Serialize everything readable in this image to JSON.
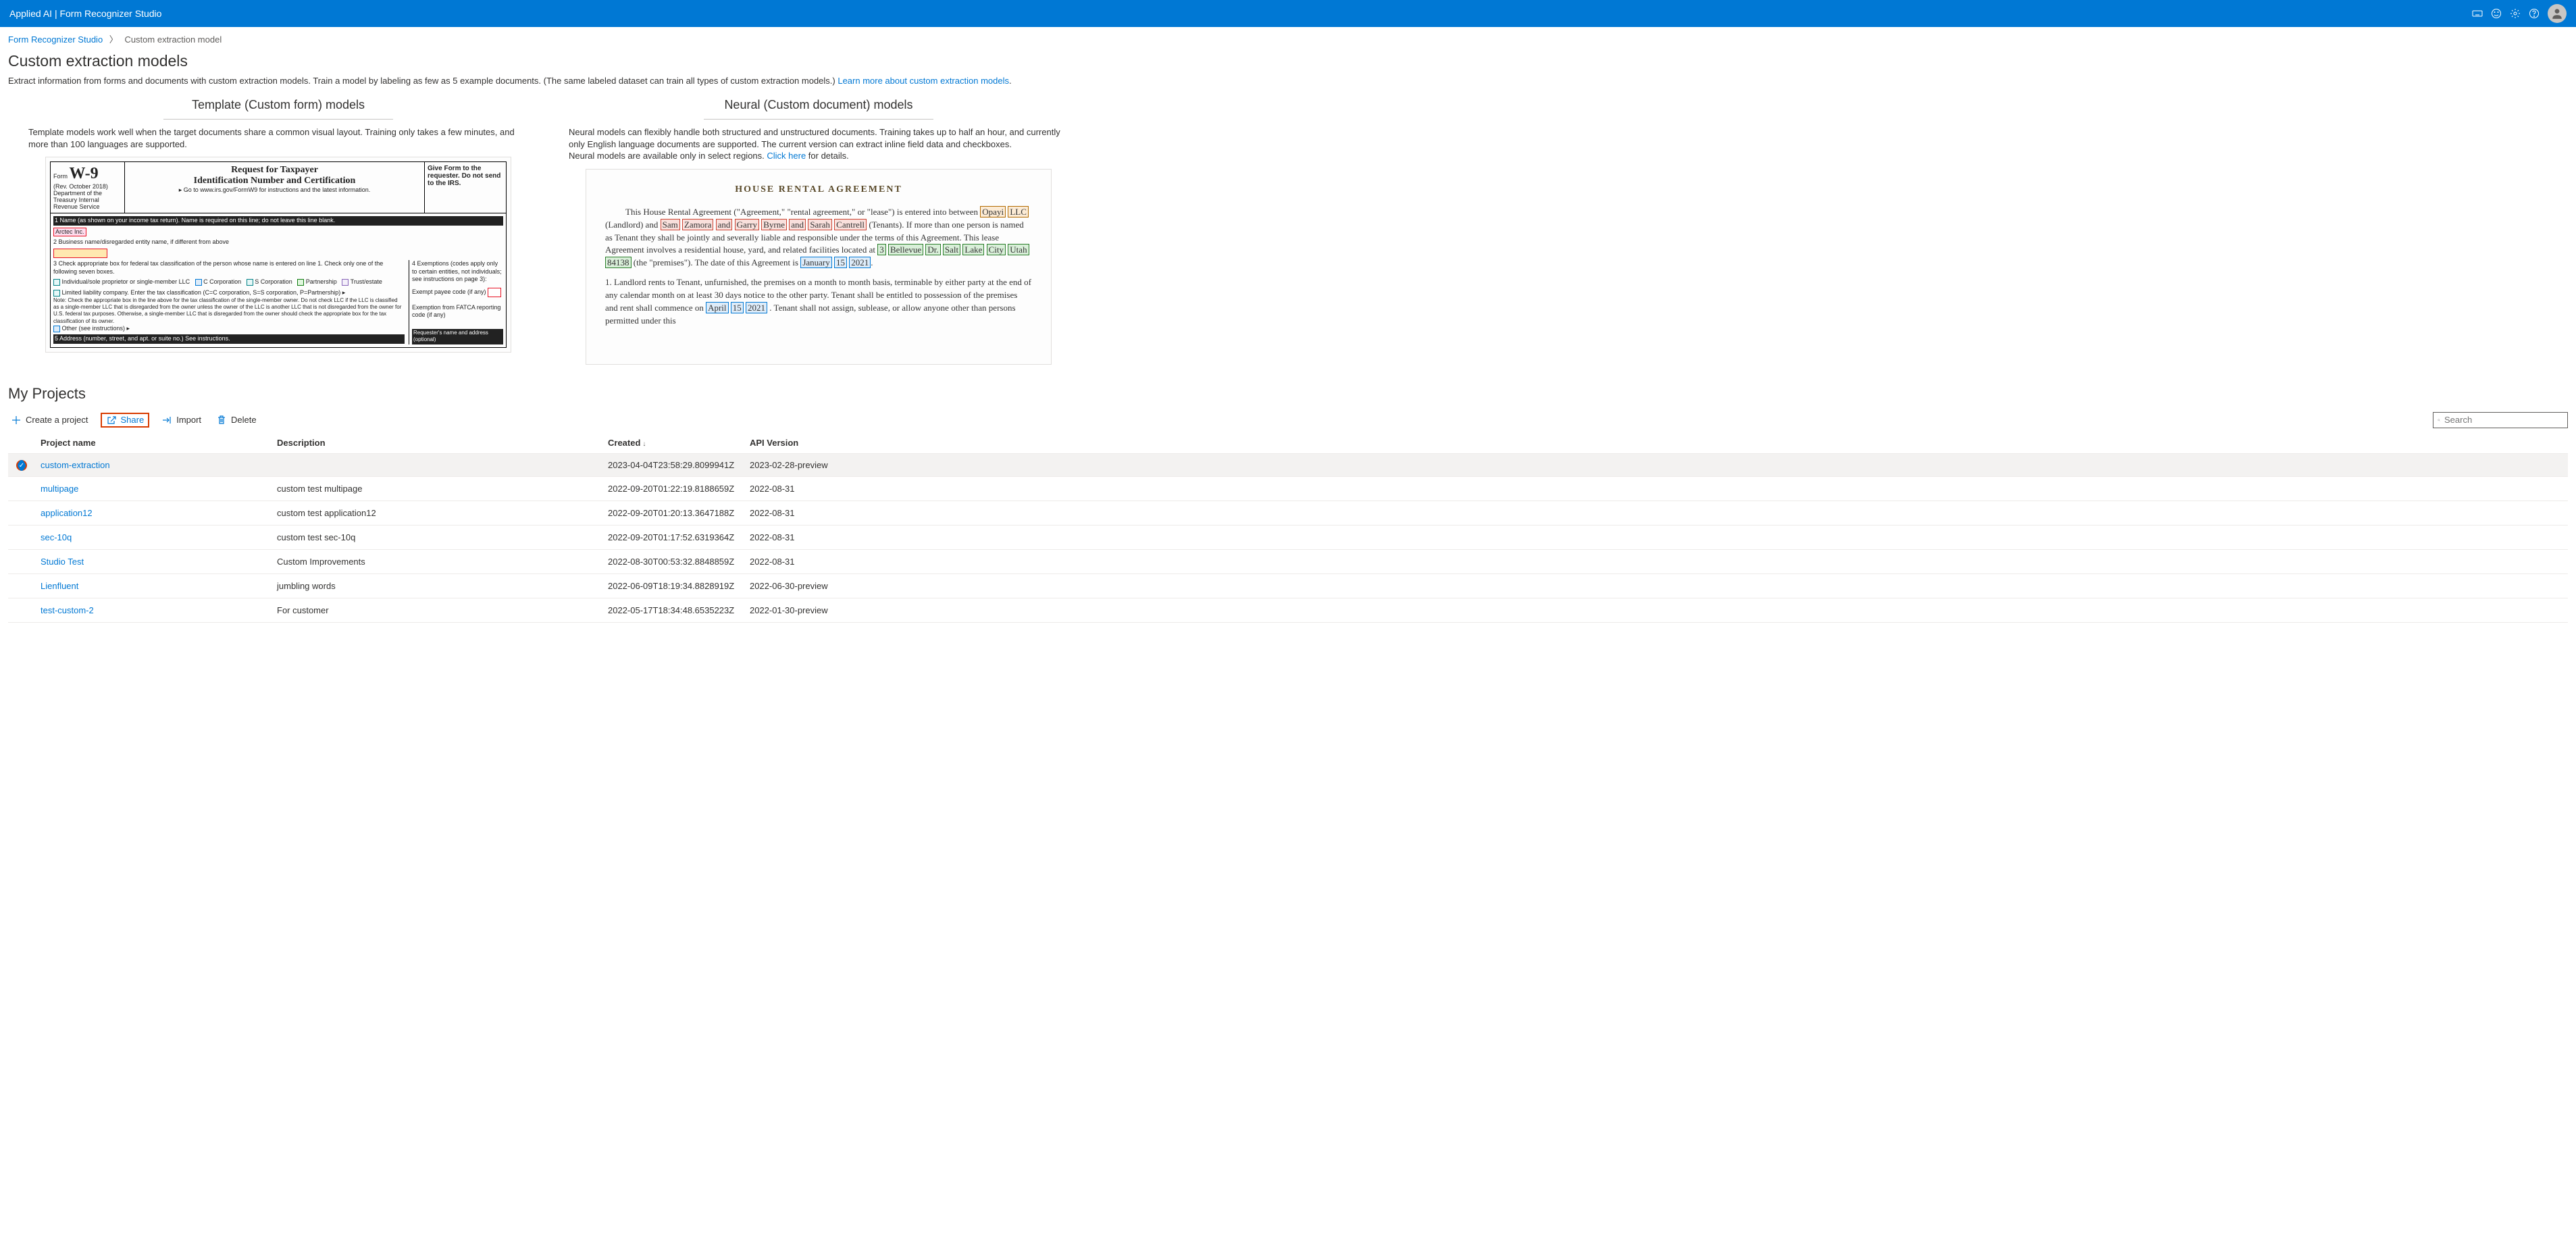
{
  "header": {
    "title": "Applied AI | Form Recognizer Studio"
  },
  "breadcrumb": {
    "root": "Form Recognizer Studio",
    "current": "Custom extraction model"
  },
  "page": {
    "title": "Custom extraction models",
    "desc_a": "Extract information from forms and documents with custom extraction models. Train a model by labeling as few as 5 example documents. (The same labeled dataset can train all types of custom extraction models.) ",
    "learn_link": "Learn more about custom extraction models",
    "desc_b": "."
  },
  "cols": {
    "template": {
      "title": "Template (Custom form) models",
      "desc": "Template models work well when the target documents share a common visual layout. Training only takes a few minutes, and more than 100 languages are supported."
    },
    "neural": {
      "title": "Neural (Custom document) models",
      "desc_a": "Neural models can flexibly handle both structured and unstructured documents. Training takes up to half an hour, and currently only English language documents are supported. The current version can extract inline field data and checkboxes.",
      "desc_b": "Neural models are available only in select regions. ",
      "click_here": "Click here",
      "desc_c": " for details."
    }
  },
  "w9": {
    "form_label": "Form",
    "big": "W-9",
    "rev": "(Rev. October 2018)",
    "dept": "Department of the Treasury Internal Revenue Service",
    "t1": "Request for Taxpayer",
    "t2": "Identification Number and Certification",
    "t3": "▸ Go to www.irs.gov/FormW9 for instructions and the latest information.",
    "right": "Give Form to the requester. Do not send to the IRS.",
    "line1": "1 Name (as shown on your income tax return). Name is required on this line; do not leave this line blank.",
    "name_hl": "Arctec Inc.",
    "line2": "2 Business name/disregarded entity name, if different from above",
    "line3": "3 Check appropriate box for federal tax classification of the person whose name is entered on line 1. Check only one of the following seven boxes.",
    "cb1": "Individual/sole proprietor or single-member LLC",
    "cb2": "C Corporation",
    "cb3": "S Corporation",
    "cb4": "Partnership",
    "cb5": "Trust/estate",
    "llc": "Limited liability company. Enter the tax classification (C=C corporation, S=S corporation, P=Partnership) ▸",
    "note": "Note: Check the appropriate box in the line above for the tax classification of the single-member owner. Do not check LLC if the LLC is classified as a single-member LLC that is disregarded from the owner unless the owner of the LLC is another LLC that is not disregarded from the owner for U.S. federal tax purposes. Otherwise, a single-member LLC that is disregarded from the owner should check the appropriate box for the tax classification of its owner.",
    "other": "Other (see instructions) ▸",
    "addr": "5 Address (number, street, and apt. or suite no.) See instructions.",
    "exempt_head": "4 Exemptions (codes apply only to certain entities, not individuals; see instructions on page 3):",
    "exempt_payee": "Exempt payee code (if any)",
    "exempt_fatca": "Exemption from FATCA reporting code (if any)",
    "req_name": "Requester's name and address (optional)"
  },
  "neural_doc": {
    "title": "HOUSE RENTAL AGREEMENT",
    "p1a": "This House Rental Agreement (\"Agreement,\" \"rental agreement,\" or \"lease\") is entered into between ",
    "landlord1": "Opayi",
    "landlord2": "LLC",
    "p1b": " (Landlord) and ",
    "t1a": "Sam",
    "t1b": "Zamora",
    "and1": "and",
    "t2a": "Garry",
    "t2b": "Byrne",
    "and2": "and",
    "t3a": "Sarah",
    "t3b": "Cantrell",
    "p1c": " (Tenants). If more than one person is named as Tenant they shall be jointly and severally liable and responsible under the terms of this Agreement. This lease Agreement involves a residential house, yard, and related facilities located at ",
    "a1": "3",
    "a2": "Bellevue",
    "a3": "Dr.",
    "a4": "Salt",
    "a5": "Lake",
    "a6": "City",
    "a7": "Utah",
    "a8": "84138",
    "p1d": " (the \"premises\"). The date of this Agreement is ",
    "d1": "January",
    "d2": "15",
    "d3": "2021",
    "p2a": "1.           Landlord rents to Tenant, unfurnished, the premises on a month to month basis, terminable by either party at the end of any calendar month on at least 30 days notice to the other party. Tenant shall be entitled to possession of the premises and rent shall commence on ",
    "m1": "April",
    "m2": "15",
    "m3": "2021",
    "p2b": ". Tenant shall not assign, sublease, or allow anyone other than persons permitted under this"
  },
  "projects": {
    "section_title": "My Projects",
    "cmd_create": "Create a project",
    "cmd_share": "Share",
    "cmd_import": "Import",
    "cmd_delete": "Delete",
    "search_placeholder": "Search",
    "cols": {
      "name": "Project name",
      "desc": "Description",
      "created": "Created",
      "api": "API Version"
    },
    "rows": [
      {
        "selected": true,
        "name": "custom-extraction",
        "desc": "",
        "created": "2023-04-04T23:58:29.8099941Z",
        "api": "2023-02-28-preview"
      },
      {
        "selected": false,
        "name": "multipage",
        "desc": "custom test multipage",
        "created": "2022-09-20T01:22:19.8188659Z",
        "api": "2022-08-31"
      },
      {
        "selected": false,
        "name": "application12",
        "desc": "custom test application12",
        "created": "2022-09-20T01:20:13.3647188Z",
        "api": "2022-08-31"
      },
      {
        "selected": false,
        "name": "sec-10q",
        "desc": "custom test sec-10q",
        "created": "2022-09-20T01:17:52.6319364Z",
        "api": "2022-08-31"
      },
      {
        "selected": false,
        "name": "Studio Test",
        "desc": "Custom Improvements",
        "created": "2022-08-30T00:53:32.8848859Z",
        "api": "2022-08-31"
      },
      {
        "selected": false,
        "name": "Lienfluent",
        "desc": "jumbling words",
        "created": "2022-06-09T18:19:34.8828919Z",
        "api": "2022-06-30-preview"
      },
      {
        "selected": false,
        "name": "test-custom-2",
        "desc": "For customer",
        "created": "2022-05-17T18:34:48.6535223Z",
        "api": "2022-01-30-preview"
      }
    ]
  }
}
